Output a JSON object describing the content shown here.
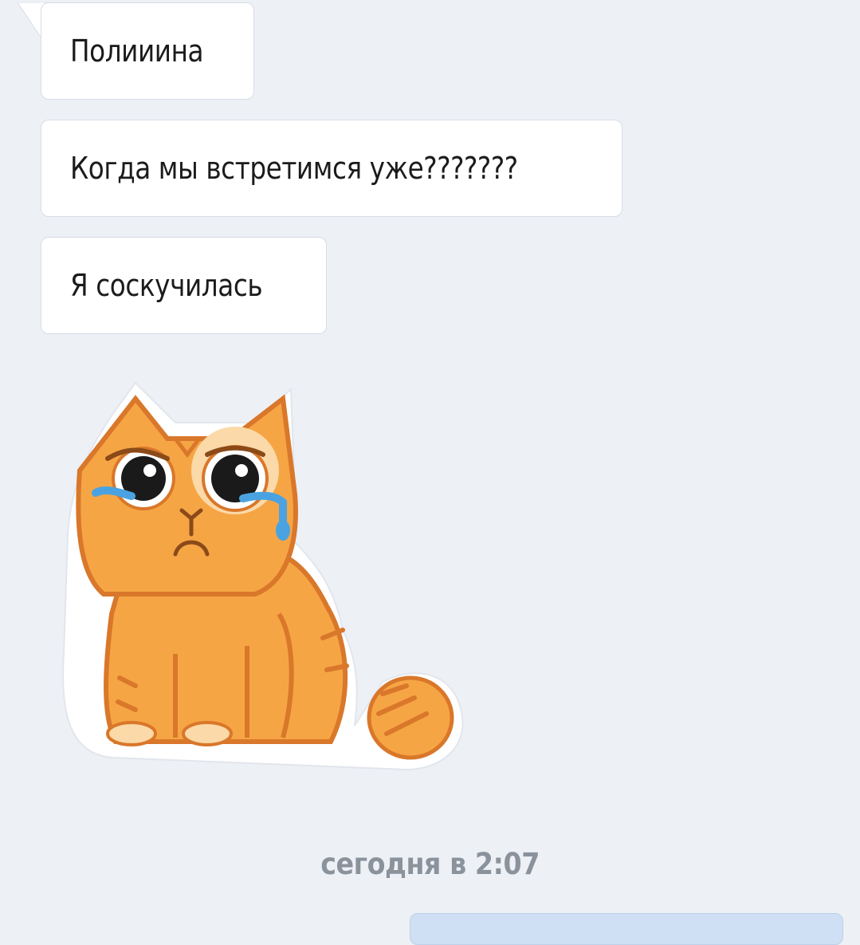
{
  "messages": [
    {
      "text": "Полииина"
    },
    {
      "text": "Когда мы встретимся уже???????"
    },
    {
      "text": "Я соскучилась"
    }
  ],
  "sticker": {
    "icon": "crying-cat-sticker"
  },
  "timestamp": "сегодня в 2:07",
  "colors": {
    "background": "#edf0f5",
    "incoming_bubble": "#ffffff",
    "outgoing_bubble": "#cfe0f4",
    "timestamp_text": "#8a929c"
  }
}
